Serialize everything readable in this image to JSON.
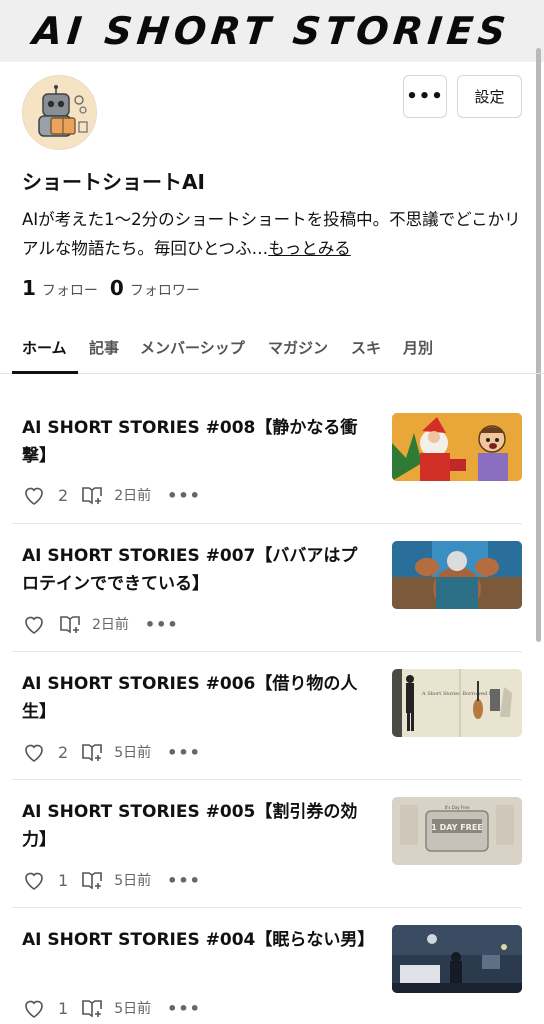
{
  "banner": {
    "title": "AI SHORT STORIES"
  },
  "header": {
    "more_label": "•••",
    "settings_label": "設定"
  },
  "profile": {
    "name": "ショートショートAI",
    "bio": "AIが考えた1〜2分のショートショートを投稿中。不思議でどこかリアルな物語たち。毎回ひとつふ…",
    "more_link": "もっとみる",
    "follow_count": "1",
    "follow_label": "フォロー",
    "follower_count": "0",
    "follower_label": "フォロワー"
  },
  "tabs": [
    "ホーム",
    "記事",
    "メンバーシップ",
    "マガジン",
    "スキ",
    "月別"
  ],
  "articles": [
    {
      "title": "AI SHORT STORIES #008【静かなる衝撃】",
      "likes": "2",
      "date": "2日前",
      "thumb": "santa-cartoon"
    },
    {
      "title": "AI SHORT STORIES #007【ババアはプロテインでできている】",
      "likes": "",
      "date": "2日前",
      "thumb": "muscle-grandma"
    },
    {
      "title": "AI SHORT STORIES #006【借り物の人生】",
      "likes": "2",
      "date": "5日前",
      "thumb": "borrowed-life"
    },
    {
      "title": "AI SHORT STORIES #005【割引券の効力】",
      "likes": "1",
      "date": "5日前",
      "thumb": "discount-coupon"
    },
    {
      "title": "AI SHORT STORIES #004【眠らない男】",
      "likes": "1",
      "date": "5日前",
      "thumb": "sleepless-man"
    }
  ],
  "dots_label": "•••",
  "thumb_texts": {
    "borrowed": "A Short Stories Borrowed Life",
    "coupon_head": "1 DAY FREE",
    "coupon_small": "It's Day Free"
  },
  "colors": {
    "text": "#111111",
    "muted": "#666666",
    "banner_bg": "#efefef",
    "divider": "#e6e6e6"
  }
}
